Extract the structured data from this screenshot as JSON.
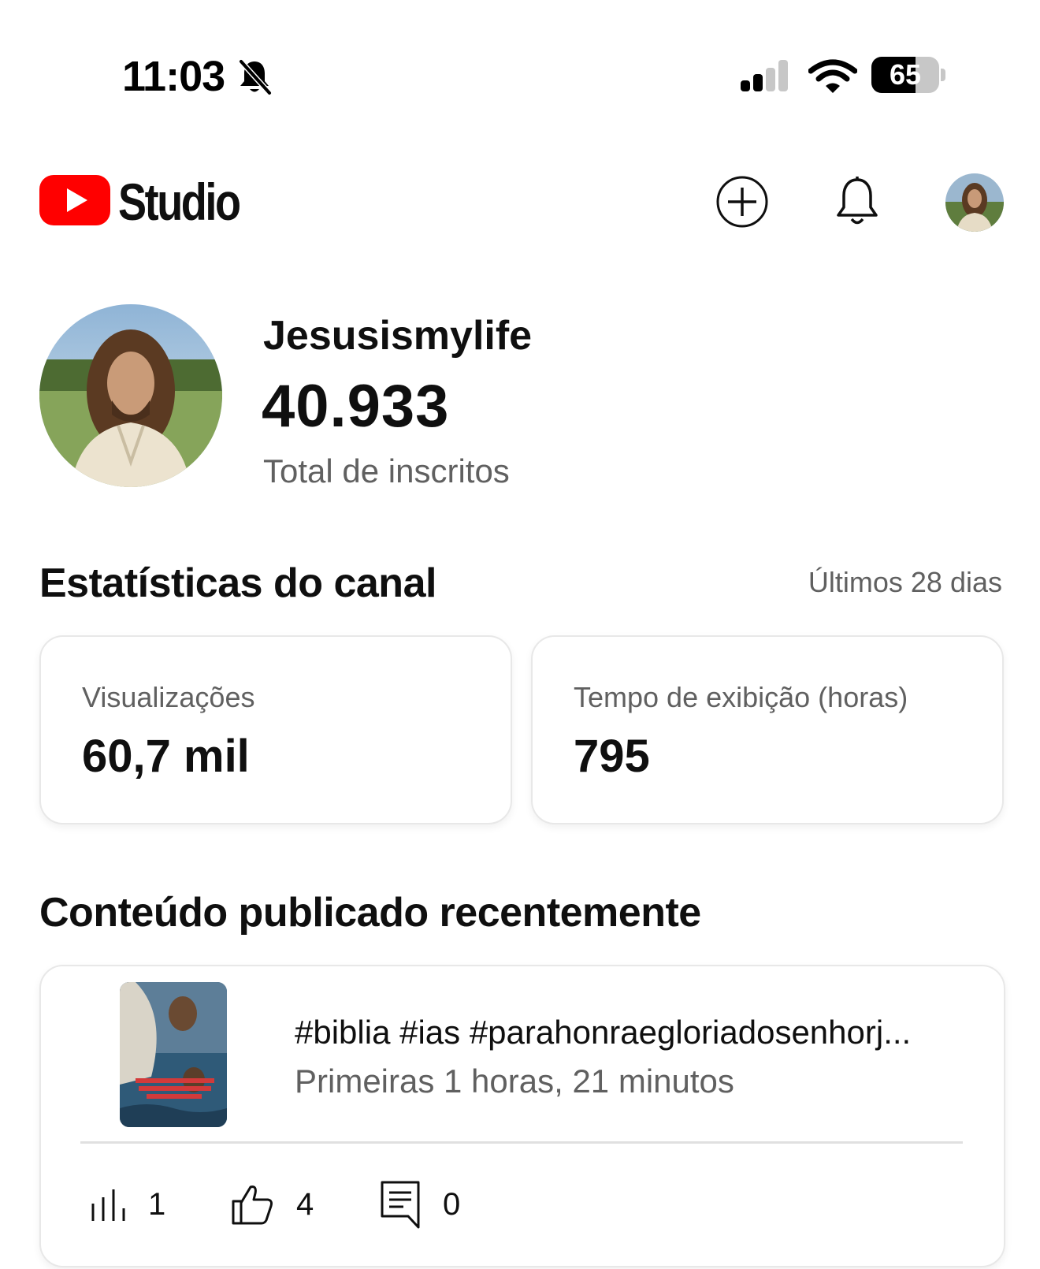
{
  "status_bar": {
    "time": "11:03",
    "battery_level": "65",
    "battery_fraction": 0.65
  },
  "header": {
    "brand": "Studio",
    "brand_color": "#ff0000",
    "icons": [
      "youtube-logo-icon",
      "create-icon",
      "bell-icon",
      "avatar"
    ]
  },
  "channel": {
    "name": "Jesusismylife",
    "subscribers": "40.933",
    "subscribers_label": "Total de inscritos"
  },
  "stats": {
    "title": "Estatísticas do canal",
    "range": "Últimos 28 dias",
    "cards": [
      {
        "label": "Visualizações",
        "value": "60,7 mil"
      },
      {
        "label": "Tempo de exibição (horas)",
        "value": "795"
      }
    ]
  },
  "recent": {
    "title": "Conteúdo publicado recentemente",
    "item": {
      "title": "#biblia #ias #parahonraegloriadosenhorj...",
      "time": "Primeiras 1 horas, 21 minutos",
      "metrics": {
        "views": "1",
        "likes": "4",
        "comments": "0"
      }
    }
  }
}
